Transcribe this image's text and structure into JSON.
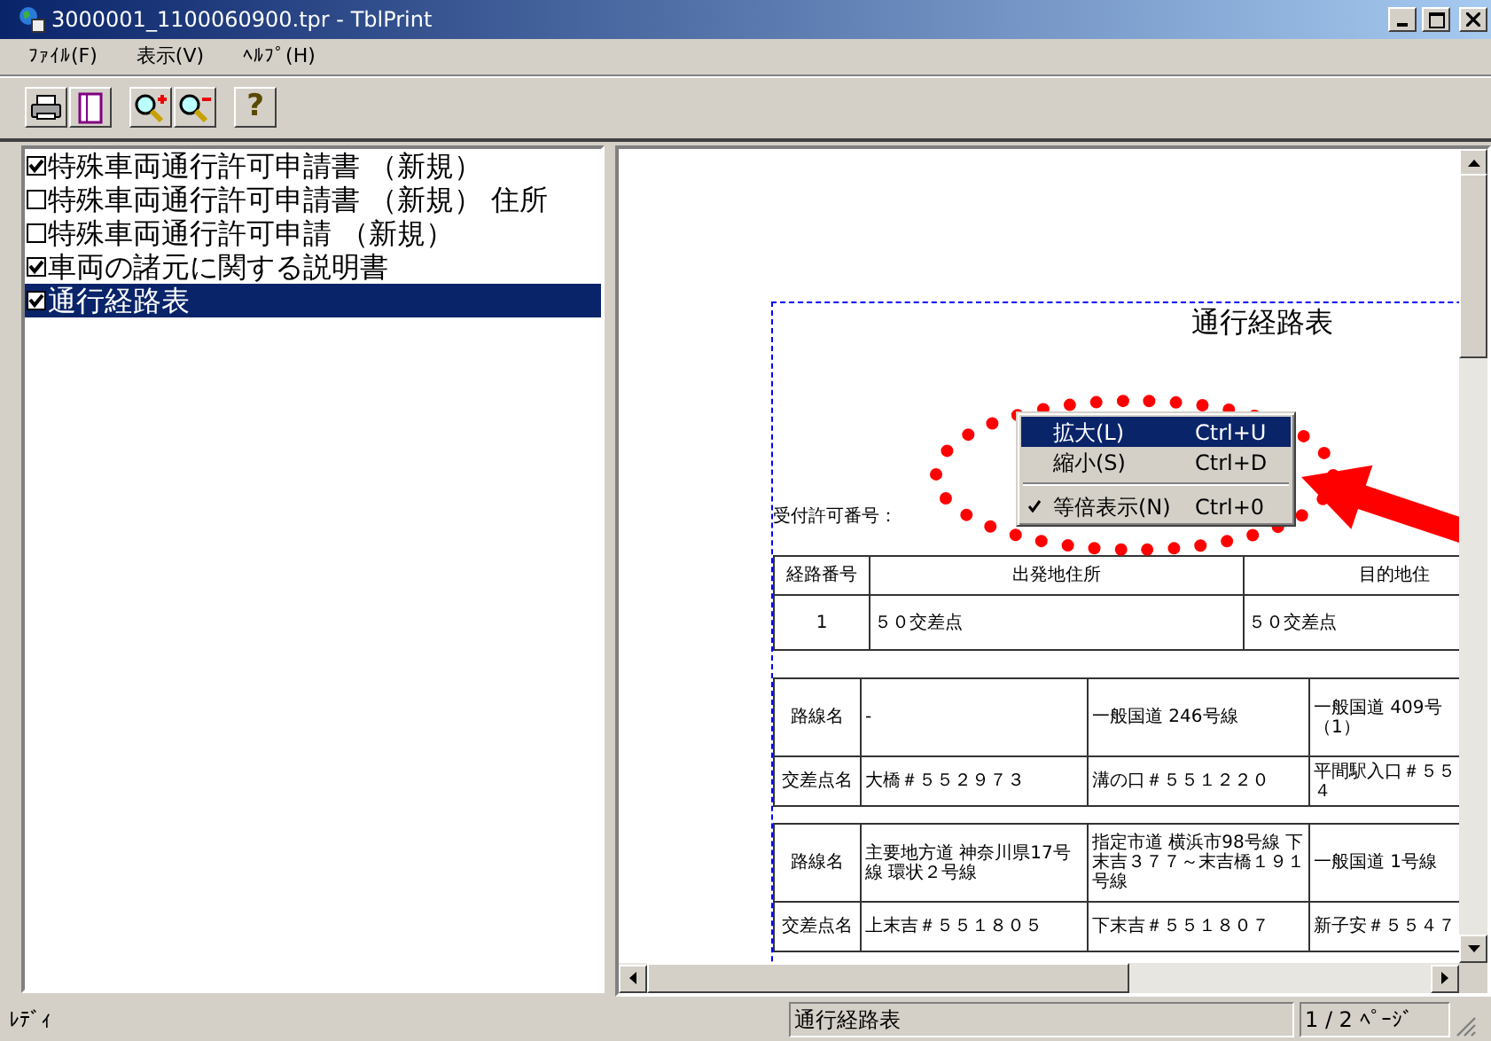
{
  "window": {
    "title": "3000001_1100060900.tpr - TblPrint"
  },
  "menu": [
    {
      "label": "ﾌｧｲﾙ(F)"
    },
    {
      "label": "表示(V)"
    },
    {
      "label": "ﾍﾙﾌﾟ(H)"
    }
  ],
  "toolbar": [
    {
      "kind": "print"
    },
    {
      "kind": "page"
    },
    {
      "kind": "zoom-in"
    },
    {
      "kind": "zoom-out"
    },
    {
      "kind": "help",
      "glyph": "?"
    }
  ],
  "documents": [
    {
      "label": "特殊車両通行許可申請書 （新規）",
      "checked": true,
      "selected": false
    },
    {
      "label": "特殊車両通行許可申請書 （新規） 住所",
      "checked": false,
      "selected": false
    },
    {
      "label": "特殊車両通行許可申請 （新規）",
      "checked": false,
      "selected": false
    },
    {
      "label": "車両の諸元に関する説明書",
      "checked": true,
      "selected": false
    },
    {
      "label": "通行経路表",
      "checked": true,
      "selected": true
    }
  ],
  "preview": {
    "title": "通行経路表",
    "permit_label": "受付許可番号：",
    "route_table": {
      "columns": [
        "経路番号",
        "出発地住所",
        "目的地住"
      ],
      "rows": [
        [
          "1",
          "５０交差点",
          "５０交差点"
        ]
      ]
    },
    "segments": [
      {
        "rows": [
          {
            "label": "路線名",
            "cells": [
              "-",
              "一般国道 246号線",
              "一般国道 409号（1）"
            ]
          },
          {
            "label": "交差点名",
            "cells": [
              "大橋＃５５２９７３",
              "溝の口＃５５１２２０",
              "平間駅入口＃５５４"
            ]
          }
        ]
      },
      {
        "rows": [
          {
            "label": "路線名",
            "cells": [
              "主要地方道 神奈川県17号線 環状２号線",
              "指定市道 横浜市98号線 下末吉３７７～末吉橋１９１号線",
              "一般国道 1号線"
            ]
          },
          {
            "label": "交差点名",
            "cells": [
              "上末吉＃５５１８０５",
              "下末吉＃５５１８０７",
              "新子安＃５５４７"
            ]
          }
        ]
      }
    ]
  },
  "context_menu": [
    {
      "kind": "item",
      "label": "拡大(L)",
      "shortcut": "Ctrl+U",
      "selected": true,
      "checked": false
    },
    {
      "kind": "item",
      "label": "縮小(S)",
      "shortcut": "Ctrl+D",
      "selected": false,
      "checked": false
    },
    {
      "kind": "separator"
    },
    {
      "kind": "item",
      "label": "等倍表示(N)",
      "shortcut": "Ctrl+0",
      "selected": false,
      "checked": true
    }
  ],
  "status_bar": {
    "message": "ﾚﾃﾞｨ",
    "document": "通行経路表",
    "page": "1 / 2 ﾍﾟｰｼﾞ"
  }
}
